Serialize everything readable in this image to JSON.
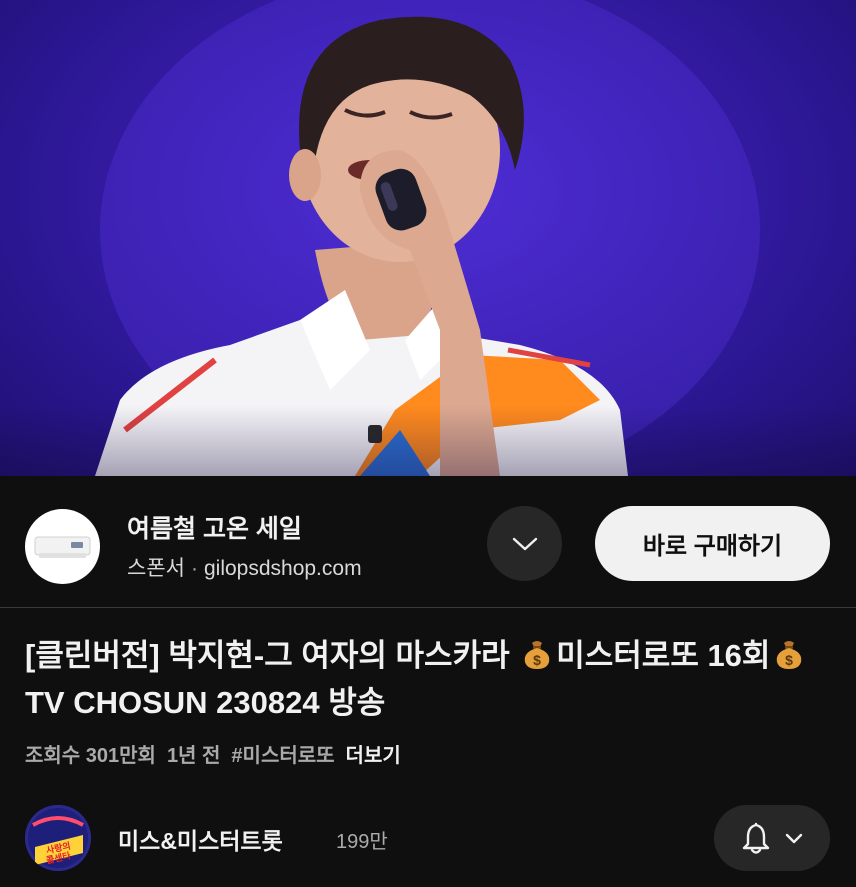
{
  "video": {
    "description_icon": "video-frame-singer"
  },
  "ad": {
    "title": "여름철 고온 세일",
    "sponsor_label": "스폰서",
    "separator": "·",
    "domain": "gilopsdshop.com",
    "expand_icon": "chevron-down-icon",
    "cta_label": "바로 구매하기"
  },
  "title": {
    "part1": "[클린버전] 박지현-그 여자의 마스카라 ",
    "part2": "미스터로또 16회",
    "part3": " TV CHOSUN 230824 방송",
    "emoji_icon": "money-bag-icon"
  },
  "meta": {
    "views": "조회수 301만회",
    "age": "1년 전",
    "hashtag": "#미스터로또",
    "more": "더보기"
  },
  "channel": {
    "name": "미스&미스터트롯",
    "subscribers": "199만",
    "avatar_text_1": "사랑의",
    "avatar_text_2": "콜센타",
    "bell_icon": "bell-icon",
    "chevron_icon": "chevron-down-icon"
  },
  "colors": {
    "background": "#0f0f0f",
    "stage_purple": "#3a1fb0",
    "cta_bg": "#f1f1f1",
    "chip_bg": "#272727"
  }
}
